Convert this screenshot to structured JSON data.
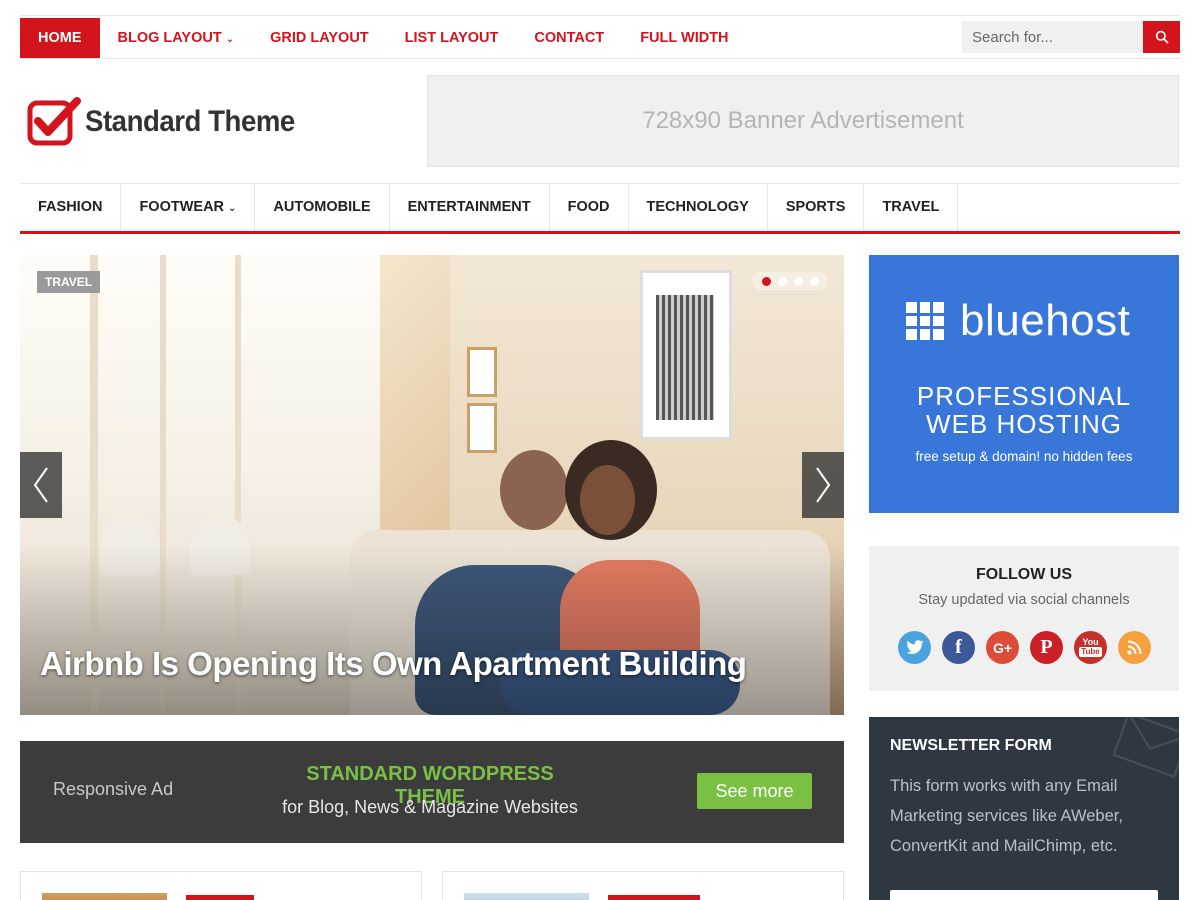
{
  "topnav": {
    "items": [
      {
        "label": "HOME"
      },
      {
        "label": "BLOG LAYOUT"
      },
      {
        "label": "GRID LAYOUT"
      },
      {
        "label": "LIST LAYOUT"
      },
      {
        "label": "CONTACT"
      },
      {
        "label": "FULL WIDTH"
      }
    ],
    "search_placeholder": "Search for..."
  },
  "header": {
    "logo_text": "Standard Theme",
    "banner_text": "728x90 Banner Advertisement"
  },
  "categories": [
    {
      "label": "FASHION"
    },
    {
      "label": "FOOTWEAR"
    },
    {
      "label": "AUTOMOBILE"
    },
    {
      "label": "ENTERTAINMENT"
    },
    {
      "label": "FOOD"
    },
    {
      "label": "TECHNOLOGY"
    },
    {
      "label": "SPORTS"
    },
    {
      "label": "TRAVEL"
    }
  ],
  "slider": {
    "tag": "TRAVEL",
    "title": "Airbnb Is Opening Its Own Apartment Building",
    "active_slide": 1,
    "slide_count": 4
  },
  "responsive_ad": {
    "label": "Responsive Ad",
    "title": "STANDARD WORDPRESS THEME",
    "subtitle": "for Blog, News & Magazine Websites",
    "button": "See more"
  },
  "sidebar": {
    "bluehost": {
      "brand": "bluehost",
      "headline_1": "PROFESSIONAL",
      "headline_2": "WEB HOSTING",
      "tagline": "free setup & domain! no hidden fees"
    },
    "follow": {
      "title": "FOLLOW US",
      "subtitle": "Stay updated via social channels",
      "icons": [
        {
          "name": "twitter-icon",
          "color": "#4aa3df"
        },
        {
          "name": "facebook-icon",
          "color": "#3b5998"
        },
        {
          "name": "google-plus-icon",
          "color": "#dd4b39"
        },
        {
          "name": "pinterest-icon",
          "color": "#cb2027"
        },
        {
          "name": "youtube-icon",
          "color": "#c4302b"
        },
        {
          "name": "rss-icon",
          "color": "#f7a03f"
        }
      ]
    },
    "newsletter": {
      "title": "NEWSLETTER FORM",
      "description": "This form works with any Email Marketing services like AWeber, ConvertKit and MailChimp, etc."
    }
  },
  "colors": {
    "accent": "#d3141c",
    "bluehost_bg": "#3877d9",
    "ad_green": "#7ac143",
    "newsletter_bg": "#2f3742"
  }
}
